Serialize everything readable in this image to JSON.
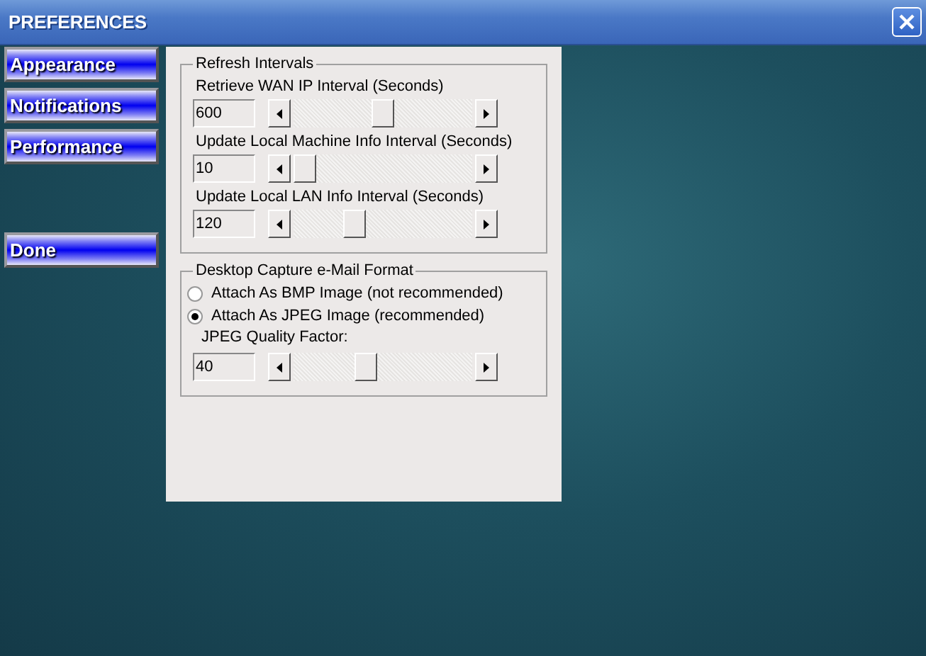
{
  "window": {
    "title": "PREFERENCES"
  },
  "sidebar": {
    "items": [
      {
        "label": "Appearance"
      },
      {
        "label": "Notifications"
      },
      {
        "label": "Performance"
      }
    ],
    "done": "Done"
  },
  "refresh_intervals": {
    "title": "Refresh Intervals",
    "settings": [
      {
        "label": "Retrieve WAN IP Interval (Seconds)",
        "value": "600",
        "level": 0.5
      },
      {
        "label": "Update Local Machine Info Interval (Seconds)",
        "value": "10",
        "level": 0.0
      },
      {
        "label": "Update Local LAN Info Interval (Seconds)",
        "value": "120",
        "level": 0.32
      }
    ]
  },
  "capture_format": {
    "title": "Desktop Capture e-Mail Format",
    "options": [
      {
        "label": "Attach As BMP Image (not recommended)",
        "selected": false
      },
      {
        "label": "Attach As JPEG Image (recommended)",
        "selected": true
      }
    ],
    "quality": {
      "label": "JPEG Quality Factor:",
      "value": "40",
      "level": 0.39
    }
  }
}
